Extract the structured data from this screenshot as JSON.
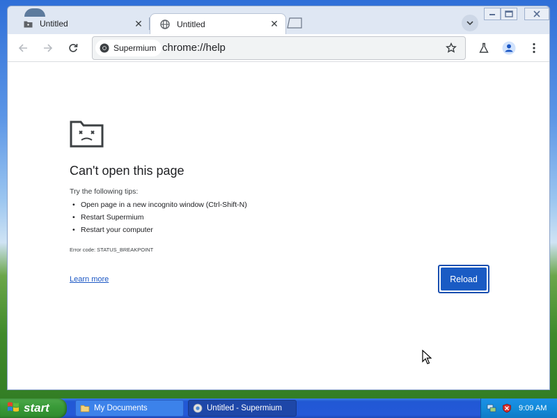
{
  "browser": {
    "tabs": [
      {
        "label": "Untitled",
        "active": false
      },
      {
        "label": "Untitled",
        "active": true
      }
    ],
    "address": {
      "chip_label": "Supermium",
      "url": "chrome://help"
    }
  },
  "page": {
    "heading": "Can't open this page",
    "tips_intro": "Try the following tips:",
    "tips": [
      "Open page in a new incognito window (Ctrl-Shift-N)",
      "Restart Supermium",
      "Restart your computer"
    ],
    "error_code": "Error code: STATUS_BREAKPOINT",
    "learn_more": "Learn more",
    "reload_button": "Reload"
  },
  "taskbar": {
    "start_label": "start",
    "tasks": [
      {
        "label": "My Documents",
        "icon": "folder-icon"
      },
      {
        "label": "Untitled - Supermium",
        "icon": "browser-icon"
      }
    ],
    "clock": "9:09 AM"
  },
  "colors": {
    "accent": "#1a5bc4",
    "link": "#1a56c4",
    "taskbar": "#2459d8",
    "start": "#3a9b39"
  }
}
